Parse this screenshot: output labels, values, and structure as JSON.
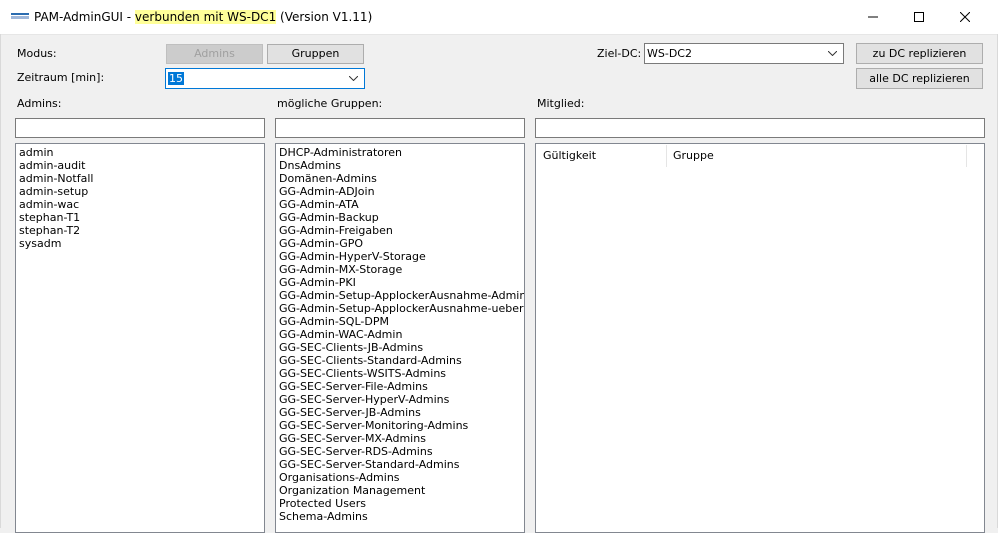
{
  "window": {
    "title_prefix": "PAM-AdminGUI - ",
    "title_status": "verbunden mit WS-DC1",
    "title_suffix": " (Version V1.11)"
  },
  "toolbar": {
    "modus_label": "Modus:",
    "admins_button": "Admins",
    "gruppen_button": "Gruppen",
    "zeitraum_label": "Zeitraum [min]:",
    "zeitraum_value": "15",
    "zieldc_label": "Ziel-DC:",
    "zieldc_value": "WS-DC2",
    "replicate_dc_button": "zu DC replizieren",
    "replicate_all_button": "alle DC replizieren"
  },
  "admins": {
    "label": "Admins:",
    "items": [
      "admin",
      "admin-audit",
      "admin-Notfall",
      "admin-setup",
      "admin-wac",
      "stephan-T1",
      "stephan-T2",
      "sysadm"
    ]
  },
  "groups": {
    "label": "mögliche Gruppen:",
    "items": [
      "DHCP-Administratoren",
      "DnsAdmins",
      "Domänen-Admins",
      "GG-Admin-ADJoin",
      "GG-Admin-ATA",
      "GG-Admin-Backup",
      "GG-Admin-Freigaben",
      "GG-Admin-GPO",
      "GG-Admin-HyperV-Storage",
      "GG-Admin-MX-Storage",
      "GG-Admin-PKI",
      "GG-Admin-Setup-ApplockerAusnahme-AdminDir",
      "GG-Admin-Setup-ApplockerAusnahme-ueberall",
      "GG-Admin-SQL-DPM",
      "GG-Admin-WAC-Admin",
      "GG-SEC-Clients-JB-Admins",
      "GG-SEC-Clients-Standard-Admins",
      "GG-SEC-Clients-WSITS-Admins",
      "GG-SEC-Server-File-Admins",
      "GG-SEC-Server-HyperV-Admins",
      "GG-SEC-Server-JB-Admins",
      "GG-SEC-Server-Monitoring-Admins",
      "GG-SEC-Server-MX-Admins",
      "GG-SEC-Server-RDS-Admins",
      "GG-SEC-Server-Standard-Admins",
      "Organisations-Admins",
      "Organization Management",
      "Protected Users",
      "Schema-Admins"
    ]
  },
  "member": {
    "label": "Mitglied:",
    "columns": [
      "Gültigkeit",
      "Gruppe"
    ]
  },
  "colors": {
    "highlight": "#ffff99",
    "accent": "#0078d7"
  }
}
